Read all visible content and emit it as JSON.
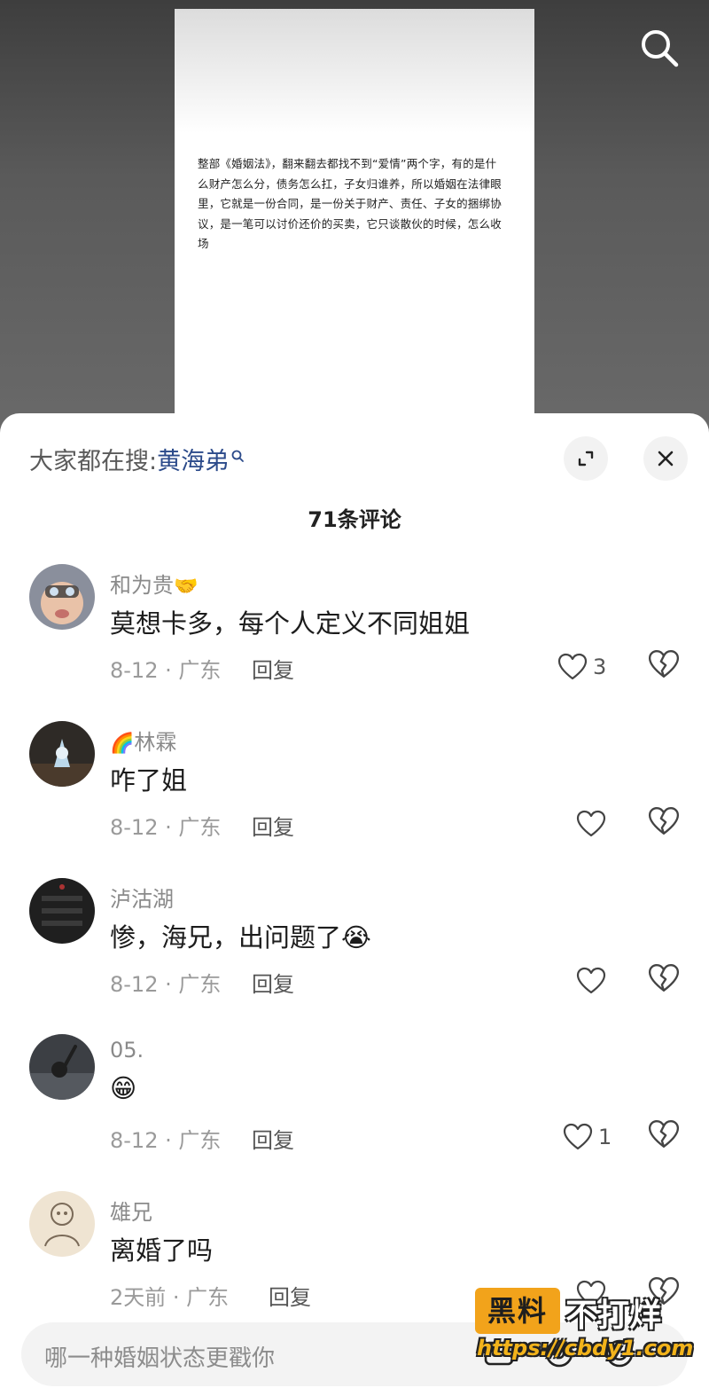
{
  "video": {
    "caption": "整部《婚姻法》，翻来翻去都找不到“爱情”两个字，有的是什么财产怎么分，债务怎么扛，子女归谁养，所以婚姻在法律眼里，它就是一份合同，是一份关于财产、责任、子女的捆绑协议，是一笔可以讨价还价的买卖，它只谈散伙的时候，怎么收场"
  },
  "top_bar": {
    "search_icon": "search-icon"
  },
  "sheet": {
    "trending_prefix": "大家都在搜:",
    "trending_keyword": "黄海弟",
    "comment_count_title": "71条评论",
    "expand_icon": "expand-icon",
    "close_icon": "close-icon"
  },
  "comments": [
    {
      "username": "和为贵",
      "username_emoji": "🤝",
      "text": "莫想卡多，每个人定义不同姐姐",
      "date": "8-12",
      "location": "广东",
      "meta": "8-12 · 广东",
      "reply_label": "回复",
      "likes": "3"
    },
    {
      "username": "林霖",
      "username_emoji": "🌈",
      "text": "咋了姐",
      "date": "8-12",
      "location": "广东",
      "meta": "8-12 · 广东",
      "reply_label": "回复",
      "likes": ""
    },
    {
      "username": "泸沽湖",
      "username_emoji": "",
      "text": "惨，海兄，出问题了",
      "text_emoji": "😭",
      "date": "8-12",
      "location": "广东",
      "meta": "8-12 · 广东",
      "reply_label": "回复",
      "likes": ""
    },
    {
      "username": "05.",
      "username_emoji": "",
      "text": "😁",
      "date": "8-12",
      "location": "广东",
      "meta": "8-12 · 广东",
      "reply_label": "回复",
      "likes": "1"
    },
    {
      "username": "雄兄",
      "username_emoji": "",
      "text": "离婚了吗",
      "date": "2天前",
      "location": "广东",
      "meta": "2天前 · 广东",
      "reply_label": "回复",
      "likes": ""
    }
  ],
  "input": {
    "placeholder": "哪一种婚姻状态更戳你"
  },
  "watermark": {
    "badge": "黑料",
    "text": "不打烊",
    "url": "https://cbdy1.com"
  },
  "colors": {
    "keyword": "#2b4a8a",
    "watermark_orange": "#f2a31b"
  }
}
